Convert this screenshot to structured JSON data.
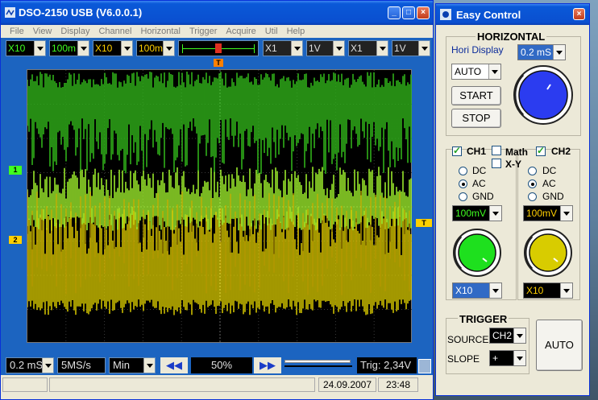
{
  "scope": {
    "title": "DSO-2150 USB (V6.0.0.1)",
    "window_buttons": [
      "_",
      "□",
      "×"
    ],
    "menu": [
      "File",
      "View",
      "Display",
      "Channel",
      "Horizontal",
      "Trigger",
      "Acquire",
      "Util",
      "Help"
    ],
    "toolbar": {
      "ch1_probe": "X10",
      "ch1_volt": "100m",
      "ch2_probe": "X10",
      "ch2_volt": "100m",
      "math1": "X1",
      "math_volt1": "1V",
      "math2": "X1",
      "math_volt2": "1V"
    },
    "markers": {
      "ch1": "1",
      "ch2": "2",
      "trigger": "T",
      "trigger_pos": "T"
    },
    "bottom": {
      "timebase": "0.2 mS",
      "sample_rate": "5MS/s",
      "mode": "Min",
      "prev": "◀◀",
      "position": "50%",
      "next": "▶▶",
      "trigger_level": "Trig: 2,34V"
    },
    "status": {
      "date": "24.09.2007",
      "time": "23:48"
    }
  },
  "easy": {
    "title": "Easy Control",
    "close": "×",
    "horizontal": {
      "title": "HORIZONTAL",
      "label": "Hori Display",
      "timebase": "0.2 mS",
      "mode": "AUTO",
      "start": "START",
      "stop": "STOP",
      "knob_color": "#2b3cf0"
    },
    "channels": {
      "ch1_label": "CH1",
      "math_label": "Math",
      "xy_label": "X-Y",
      "ch2_label": "CH2",
      "ch1": {
        "coupling": [
          "DC",
          "AC",
          "GND"
        ],
        "selected": "AC",
        "volt": "100mV",
        "probe": "X10",
        "knob_color": "#1ee01e"
      },
      "ch2": {
        "coupling": [
          "DC",
          "AC",
          "GND"
        ],
        "selected": "AC",
        "volt": "100mV",
        "probe": "X10",
        "knob_color": "#d8cc00"
      }
    },
    "trigger": {
      "title": "TRIGGER",
      "source_label": "SOURCE",
      "source": "CH2",
      "slope_label": "SLOPE",
      "slope": "+",
      "auto": "AUTO"
    }
  }
}
